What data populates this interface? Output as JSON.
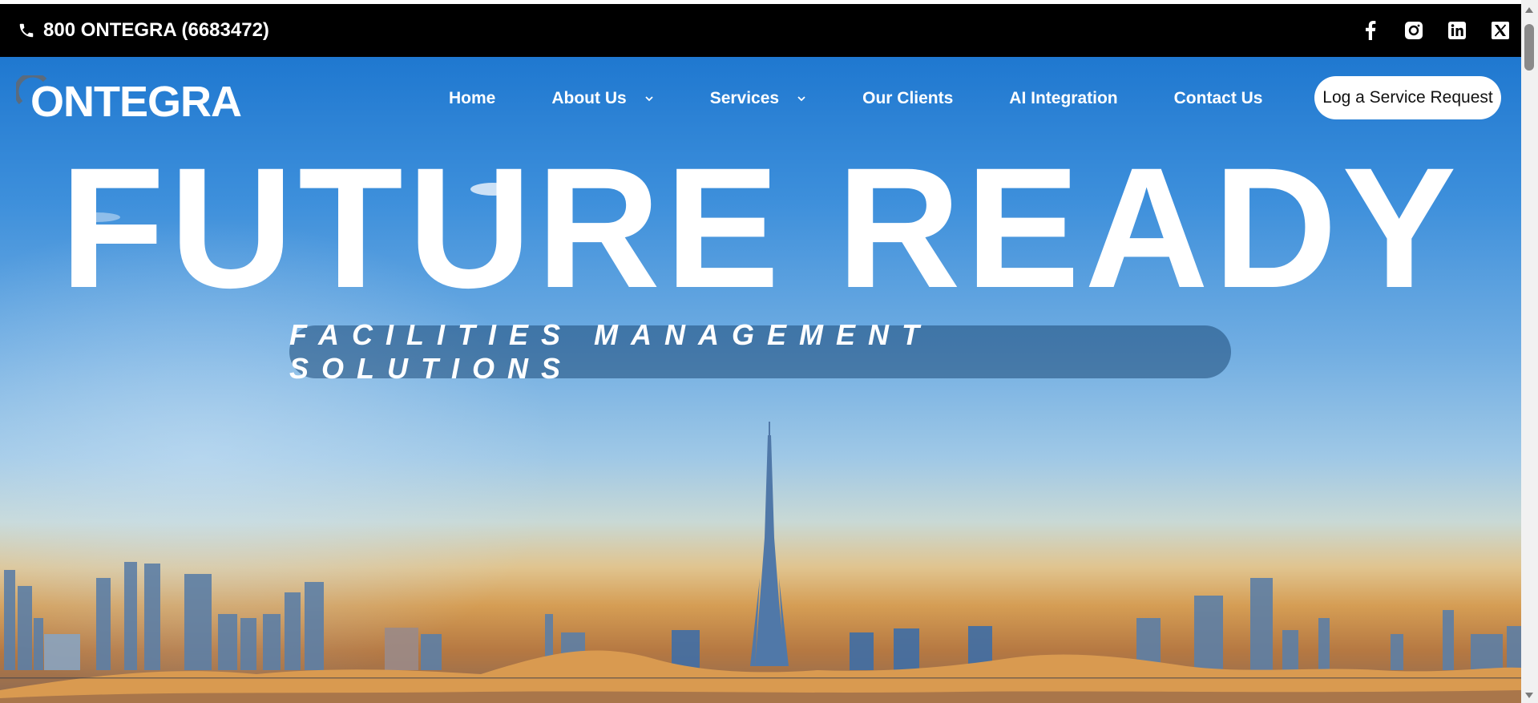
{
  "topbar": {
    "phone": "800 ONTEGRA (6683472)",
    "phone_icon": "phone-icon",
    "socials": [
      "facebook-icon",
      "instagram-icon",
      "linkedin-icon",
      "x-twitter-icon"
    ]
  },
  "brand": {
    "logo_text": "ONTEGRA"
  },
  "nav": {
    "items": [
      {
        "label": "Home",
        "has_dropdown": false
      },
      {
        "label": "About Us",
        "has_dropdown": true
      },
      {
        "label": "Services",
        "has_dropdown": true
      },
      {
        "label": "Our Clients",
        "has_dropdown": false
      },
      {
        "label": "AI Integration",
        "has_dropdown": false
      },
      {
        "label": "Contact Us",
        "has_dropdown": false
      }
    ],
    "cta_label": "Log a Service Request"
  },
  "hero": {
    "headline": "FUTURE READY",
    "tagline": "FACILITIES MANAGEMENT SOLUTIONS"
  },
  "colors": {
    "topbar_bg": "#000000",
    "sky_top": "#1f78d0",
    "sand": "#d59d54",
    "logo_arc": "#5a6b7e",
    "cta_bg": "#ffffff"
  }
}
